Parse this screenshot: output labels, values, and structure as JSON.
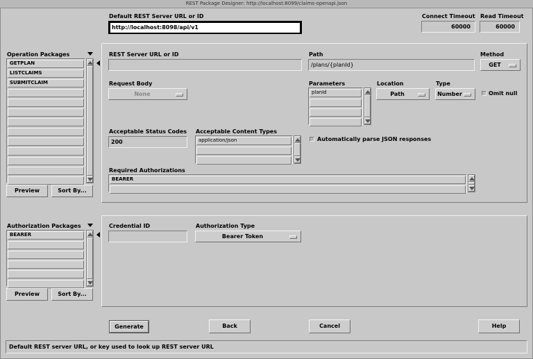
{
  "window": {
    "title": "REST Package Designer: http://localhost:8099/claims-openapi.json"
  },
  "top": {
    "default_url_label": "Default REST Server URL or ID",
    "default_url_value": "http://localhost:8098/api/v1",
    "connect_timeout_label": "Connect Timeout",
    "connect_timeout_value": "60000",
    "read_timeout_label": "Read Timeout",
    "read_timeout_value": "60000"
  },
  "operation_packages": {
    "label": "Operation Packages",
    "items": [
      "GETPLAN",
      "LISTCLAIMS",
      "SUBMITCLAIM"
    ],
    "preview_label": "Preview",
    "sort_label": "Sort By..."
  },
  "operation_detail": {
    "server_url_label": "REST Server URL or ID",
    "server_url_value": "",
    "path_label": "Path",
    "path_value": "/plans/{planId}",
    "method_label": "Method",
    "method_value": "GET",
    "request_body_label": "Request Body",
    "request_body_value": "None",
    "parameters_label": "Parameters",
    "parameters": [
      "planId"
    ],
    "location_label": "Location",
    "location_value": "Path",
    "type_label": "Type",
    "type_value": "Number",
    "omit_null_label": "Omit null",
    "status_codes_label": "Acceptable Status Codes",
    "status_codes_value": "200",
    "content_types_label": "Acceptable Content Types",
    "content_types": [
      "application/json"
    ],
    "auto_parse_label": "Automatically parse JSON responses",
    "required_auth_label": "Required Authorizations",
    "required_auths": [
      "BEARER"
    ]
  },
  "authorization_packages": {
    "label": "Authorization Packages",
    "items": [
      "BEARER"
    ],
    "preview_label": "Preview",
    "sort_label": "Sort By..."
  },
  "auth_detail": {
    "credential_label": "Credential ID",
    "credential_value": "",
    "auth_type_label": "Authorization Type",
    "auth_type_value": "Bearer Token"
  },
  "actions": {
    "generate": "Generate",
    "back": "Back",
    "cancel": "Cancel",
    "help": "Help"
  },
  "status_text": "Default REST server URL, or key used to look up REST server URL"
}
